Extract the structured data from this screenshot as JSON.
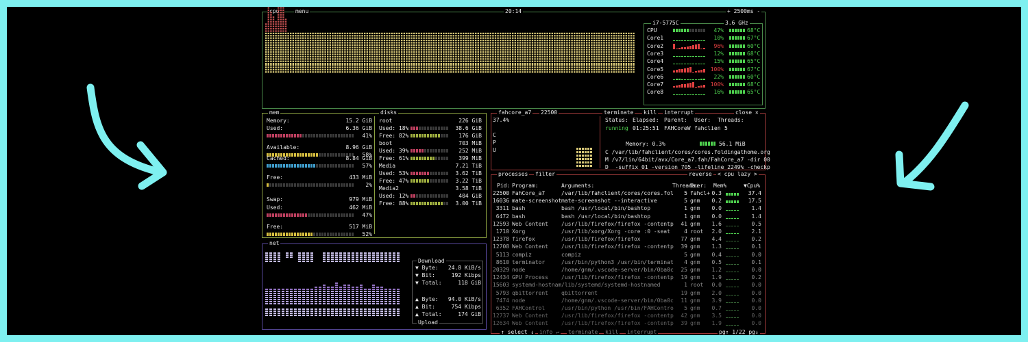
{
  "colors": {
    "border_outer": "#7ef0f0",
    "cpu_box": "#4a8a4a",
    "mem_box": "#8aa040",
    "net_box": "#5a4aa0",
    "proc_box": "#a03a3a",
    "mem_bar": "#d8c040",
    "cached_bar": "#40a0d0",
    "used_bar": "#c04060",
    "net_bar": "#9070c0",
    "cpu_bar": "#d8c878",
    "good": "#4fd14f",
    "bad": "#e04040"
  },
  "cpu": {
    "title": "cpu",
    "menu": "menu",
    "clock": "20:14",
    "interval": "+ 2500ms -",
    "model": "i7-5775C",
    "freq": "3.6 GHz",
    "cores": [
      {
        "label": "CPU",
        "pct": "47%",
        "temp": "68°C",
        "pct_val": 47
      },
      {
        "label": "Core1",
        "pct": "10%",
        "temp": "67°C",
        "pct_val": 10
      },
      {
        "label": "Core2",
        "pct": "96%",
        "temp": "60°C",
        "pct_val": 96
      },
      {
        "label": "Core3",
        "pct": "12%",
        "temp": "68°C",
        "pct_val": 12
      },
      {
        "label": "Core4",
        "pct": "15%",
        "temp": "65°C",
        "pct_val": 15
      },
      {
        "label": "Core5",
        "pct": "100%",
        "temp": "67°C",
        "pct_val": 100
      },
      {
        "label": "Core6",
        "pct": "22%",
        "temp": "60°C",
        "pct_val": 22
      },
      {
        "label": "Core7",
        "pct": "100%",
        "temp": "68°C",
        "pct_val": 100
      },
      {
        "label": "Core8",
        "pct": "16%",
        "temp": "65°C",
        "pct_val": 16
      }
    ]
  },
  "mem": {
    "title": "mem",
    "items": [
      {
        "label": "Memory:",
        "value": "15.2 GiB",
        "pct": "",
        "pct_val": null
      },
      {
        "label": "Used:",
        "value": "6.36 GiB",
        "pct": "41%",
        "pct_val": 41
      },
      {
        "label": "Available:",
        "value": "8.96 GiB",
        "pct": "58%",
        "pct_val": 58
      },
      {
        "label": "Cached:",
        "value": "8.84 GiB",
        "pct": "57%",
        "pct_val": 57
      },
      {
        "label": "Free:",
        "value": "433 MiB",
        "pct": "2%",
        "pct_val": 2
      },
      {
        "label": "Swap:",
        "value": "979 MiB",
        "pct": "",
        "pct_val": null
      },
      {
        "label": "Used:",
        "value": "462 MiB",
        "pct": "47%",
        "pct_val": 47
      },
      {
        "label": "Free:",
        "value": "517 MiB",
        "pct": "52%",
        "pct_val": 52
      }
    ]
  },
  "disks": {
    "title": "disks",
    "items": [
      {
        "name": "root",
        "total": "226 GiB",
        "used_pct": "Used: 18%",
        "used": "38.6 GiB",
        "free_pct": "Free: 82%",
        "free": "176 GiB",
        "used_val": 18,
        "free_val": 82
      },
      {
        "name": "boot",
        "total": "703 MiB",
        "used_pct": "Used: 39%",
        "used": "252 MiB",
        "free_pct": "Free: 61%",
        "free": "399 MiB",
        "used_val": 39,
        "free_val": 61
      },
      {
        "name": "Media",
        "total": "7.21 TiB",
        "used_pct": "Used: 53%",
        "used": "3.62 TiB",
        "free_pct": "Free: 47%",
        "free": "3.22 TiB",
        "used_val": 53,
        "free_val": 47
      },
      {
        "name": "Media2",
        "total": "3.58 TiB",
        "used_pct": "Used: 12%",
        "used": "404 GiB",
        "free_pct": "Free: 88%",
        "free": "3.00 TiB",
        "used_val": 12,
        "free_val": 88
      }
    ]
  },
  "net": {
    "title": "net",
    "download_title": "Download",
    "upload_title": "Upload",
    "rows": [
      {
        "label": "▼ Byte:",
        "value": "24.8 KiB/s"
      },
      {
        "label": "▼ Bit:",
        "value": "192 Kibps"
      },
      {
        "label": "▼ Total:",
        "value": "118 GiB"
      },
      {
        "label": "▲ Byte:",
        "value": "94.0 KiB/s"
      },
      {
        "label": "▲ Bit:",
        "value": "754 Kibps"
      },
      {
        "label": "▲ Total:",
        "value": "174 GiB"
      }
    ]
  },
  "detail": {
    "name": "fahcore_a7",
    "pid": "22500",
    "pct": "37.4%",
    "cpu_letters": [
      "C",
      "P",
      "U"
    ],
    "buttons": {
      "terminate": "terminate",
      "kill": "kill",
      "interrupt": "interrupt",
      "close": "close ×"
    },
    "headers": [
      "Status:",
      "Elapsed:",
      "Parent:",
      "User:",
      "Threads:"
    ],
    "values": [
      "running",
      "01:25:51",
      "FAHCoreW",
      "fahclien",
      "5"
    ],
    "memory_label": "Memory: 0.3%",
    "memory_value": "56.1 MiB",
    "cmd": [
      "C /var/lib/fahclient/cores/cores.foldingathome.org",
      "M /v7/lin/64bit/avx/Core_a7.fah/FahCore_a7 -dir 00",
      "D  -suffix 01 -version 705 -lifeline 2249% -checkp"
    ]
  },
  "processes": {
    "title": "processes",
    "filter": "filter",
    "reverse": "reverse",
    "sort": "< cpu lazy >",
    "columns": [
      "Pid:",
      "Program:",
      "Arguments:",
      "Threads:",
      "User:",
      "Mem%",
      "▼Cpu%"
    ],
    "rows": [
      {
        "pid": "22500",
        "program": "FahCore_a7",
        "args": "/var/lib/fahclient/cores/cores.fold",
        "threads": "5",
        "user": "fahcl+",
        "mem": "0.3",
        "cpu": "37.4"
      },
      {
        "pid": "16036",
        "program": "mate-screenshot",
        "args": "mate-screenshot --interactive",
        "threads": "5",
        "user": "gnm",
        "mem": "0.2",
        "cpu": "17.5"
      },
      {
        "pid": "3311",
        "program": "bash",
        "args": "bash /usr/local/bin/bashtop",
        "threads": "1",
        "user": "gnm",
        "mem": "0.0",
        "cpu": "1.4"
      },
      {
        "pid": "6472",
        "program": "bash",
        "args": "bash /usr/local/bin/bashtop",
        "threads": "1",
        "user": "gnm",
        "mem": "0.0",
        "cpu": "1.4"
      },
      {
        "pid": "12593",
        "program": "Web Content",
        "args": "/usr/lib/firefox/firefox -contentpr",
        "threads": "41",
        "user": "gnm",
        "mem": "1.6",
        "cpu": "0.5"
      },
      {
        "pid": "1710",
        "program": "Xorg",
        "args": "/usr/lib/xorg/Xorg -core :0 -seat s",
        "threads": "4",
        "user": "root",
        "mem": "2.0",
        "cpu": "2.1"
      },
      {
        "pid": "12378",
        "program": "firefox",
        "args": "/usr/lib/firefox/firefox",
        "threads": "77",
        "user": "gnm",
        "mem": "4.4",
        "cpu": "0.2"
      },
      {
        "pid": "12708",
        "program": "Web Content",
        "args": "/usr/lib/firefox/firefox -contentpr",
        "threads": "39",
        "user": "gnm",
        "mem": "1.3",
        "cpu": "0.1"
      },
      {
        "pid": "5113",
        "program": "compiz",
        "args": "compiz",
        "threads": "5",
        "user": "gnm",
        "mem": "0.4",
        "cpu": "0.0"
      },
      {
        "pid": "8610",
        "program": "terminator",
        "args": "/usr/bin/python3 /usr/bin/terminato",
        "threads": "4",
        "user": "gnm",
        "mem": "0.5",
        "cpu": "0.1"
      },
      {
        "pid": "20329",
        "program": "node",
        "args": "/home/gnm/.vscode-server/bin/0ba0ca",
        "threads": "25",
        "user": "gnm",
        "mem": "1.2",
        "cpu": "0.0"
      },
      {
        "pid": "12434",
        "program": "GPU Process",
        "args": "/usr/lib/firefox/firefox -contentpr",
        "threads": "19",
        "user": "gnm",
        "mem": "1.9",
        "cpu": "0.2"
      },
      {
        "pid": "15603",
        "program": "systemd-hostnam",
        "args": "/lib/systemd/systemd-hostnamed",
        "threads": "1",
        "user": "root",
        "mem": "0.0",
        "cpu": "0.0"
      },
      {
        "pid": "5793",
        "program": "qbittorrent",
        "args": "qbittorrent",
        "threads": "19",
        "user": "gnm",
        "mem": "2.0",
        "cpu": "0.0"
      },
      {
        "pid": "7474",
        "program": "node",
        "args": "/home/gnm/.vscode-server/bin/0ba0ca",
        "threads": "11",
        "user": "gnm",
        "mem": "3.9",
        "cpu": "0.0"
      },
      {
        "pid": "6352",
        "program": "FAHControl",
        "args": "/usr/bin/python /usr/bin/FAHControl",
        "threads": "5",
        "user": "gnm",
        "mem": "0.7",
        "cpu": "0.0"
      },
      {
        "pid": "12737",
        "program": "Web Content",
        "args": "/usr/lib/firefox/firefox -contentpr",
        "threads": "42",
        "user": "gnm",
        "mem": "3.5",
        "cpu": "0.0"
      },
      {
        "pid": "12634",
        "program": "Web Content",
        "args": "/usr/lib/firefox/firefox -contentpr",
        "threads": "39",
        "user": "gnm",
        "mem": "1.9",
        "cpu": "0.0"
      }
    ],
    "footer": {
      "select": "↑ select ↓",
      "info": "info ↵",
      "terminate": "terminate",
      "kill": "kill",
      "interrupt": "interrupt",
      "page": "pg↑ 1/22 pg↓"
    }
  }
}
